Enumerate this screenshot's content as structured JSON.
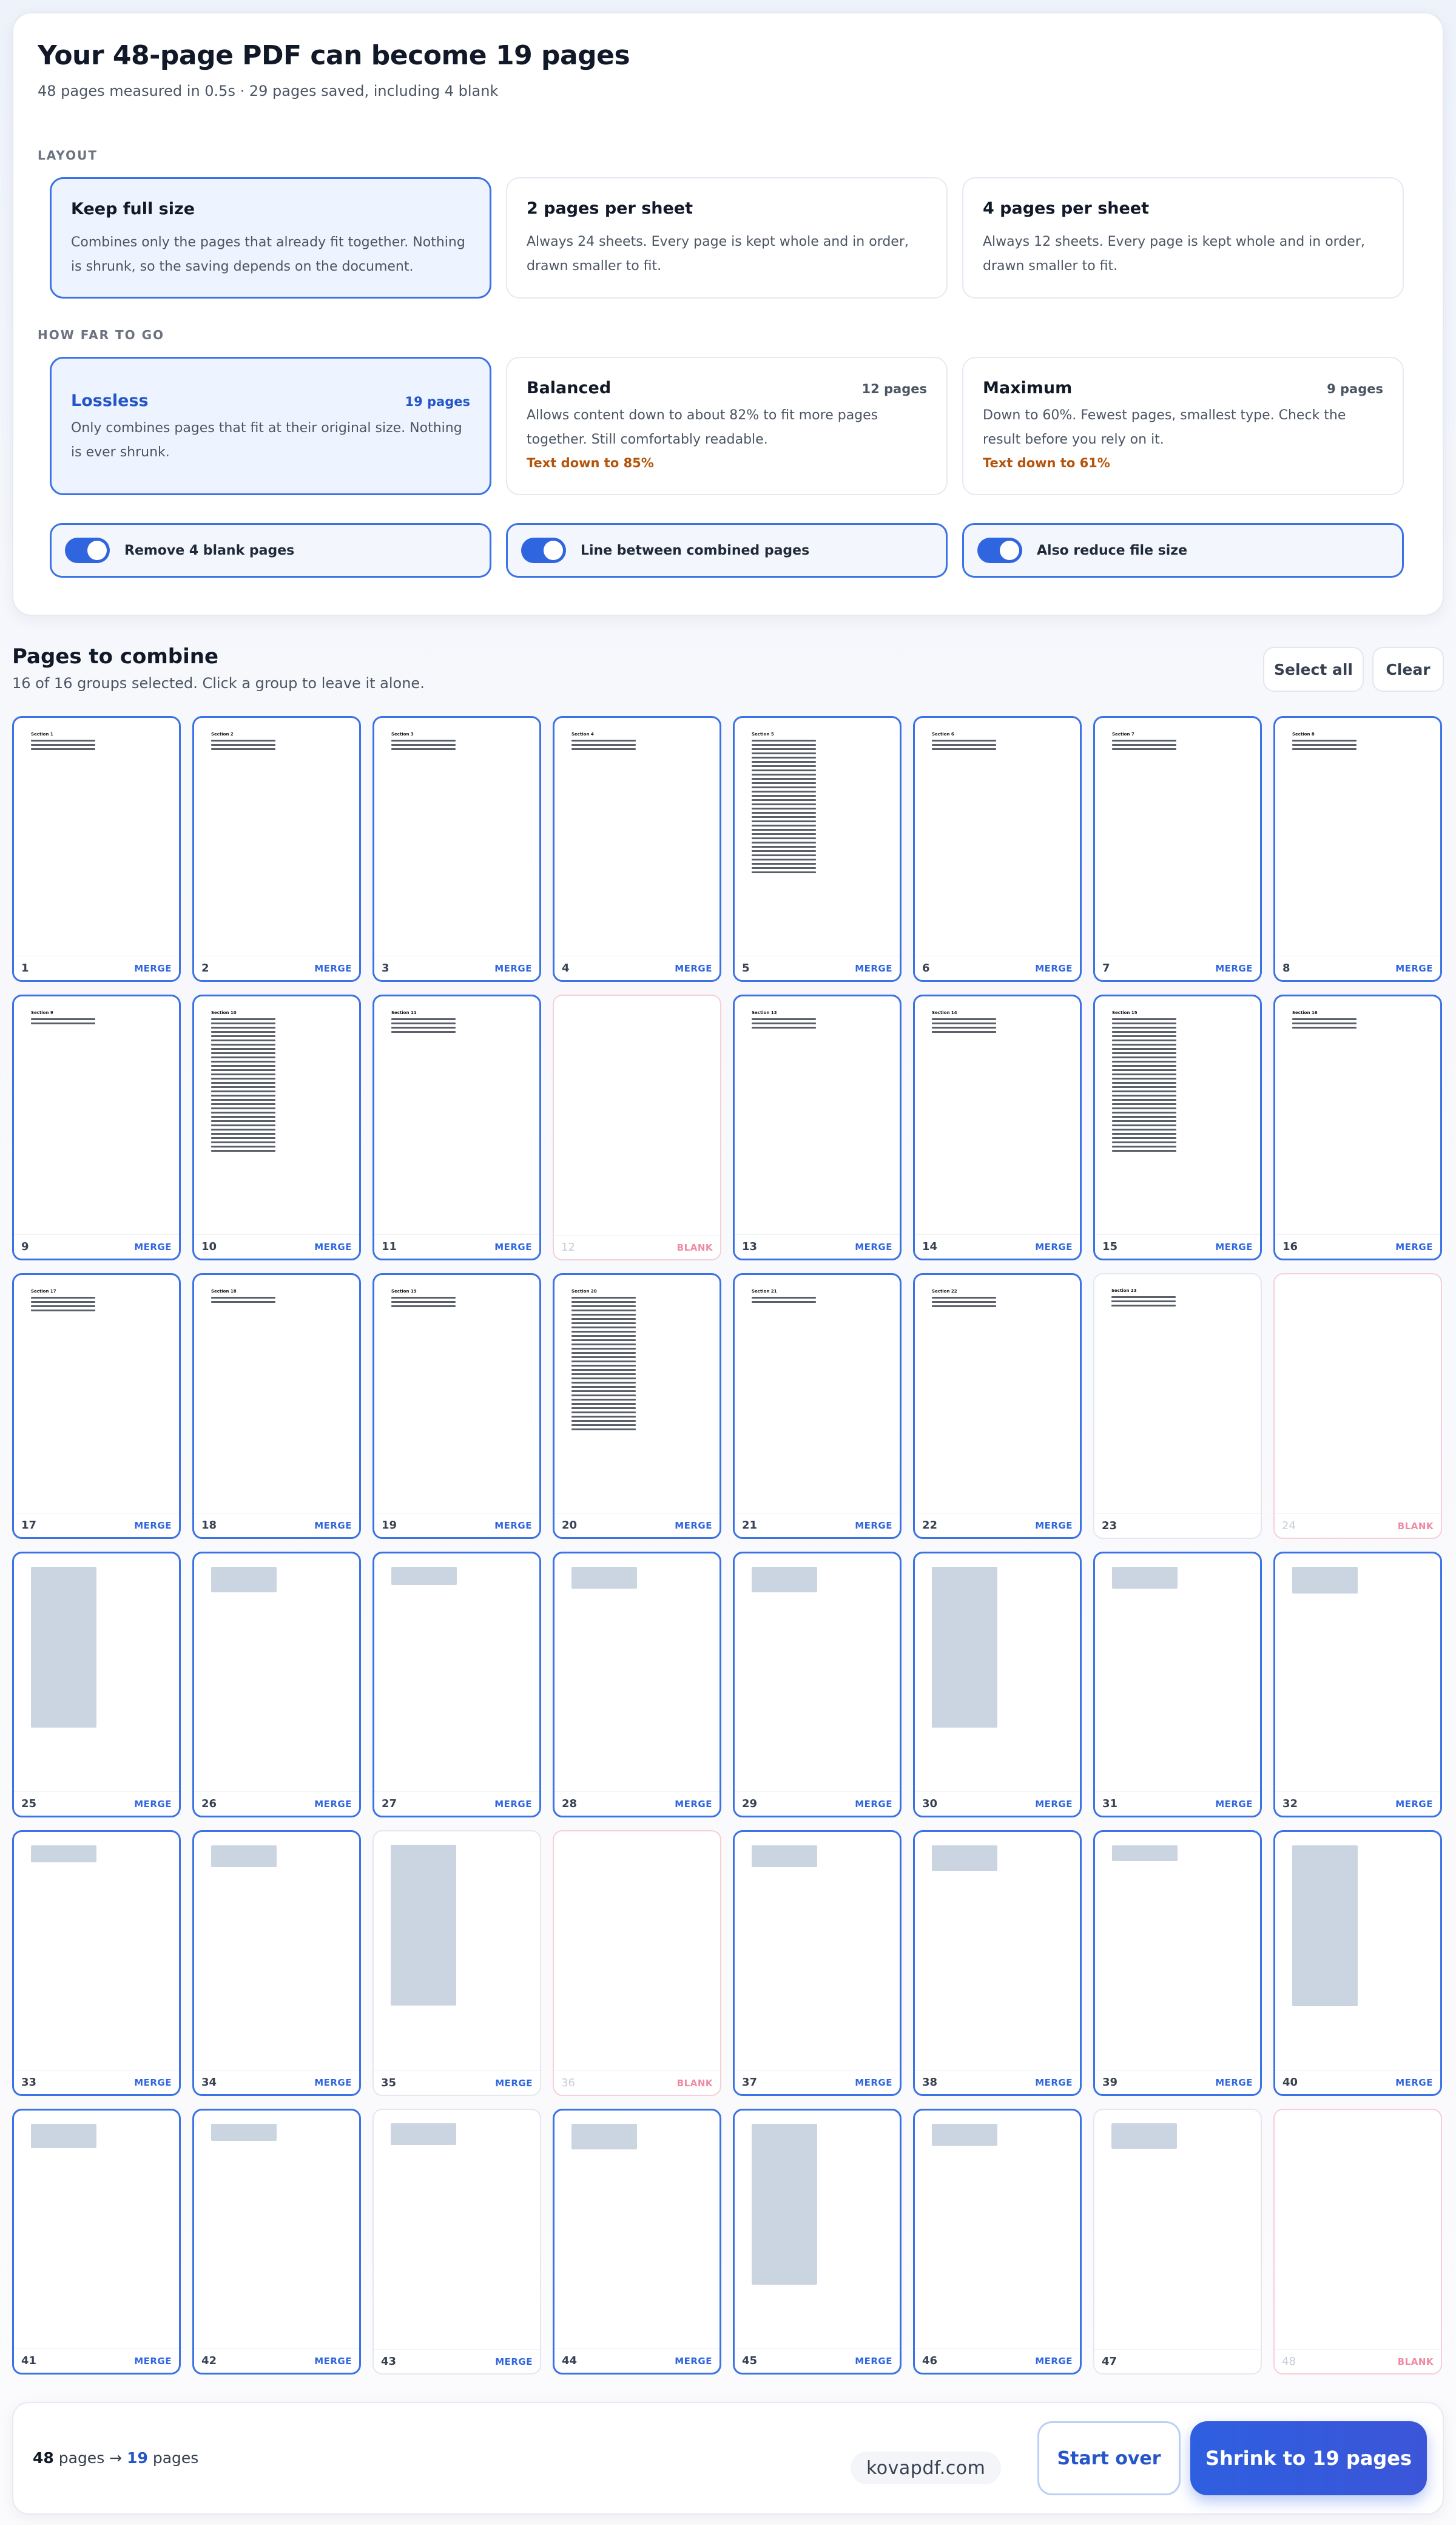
{
  "header": {
    "title": "Your 48-page PDF can become 19 pages",
    "subtitle": "48 pages measured in 0.5s · 29 pages saved, including 4 blank"
  },
  "layout": {
    "label": "LAYOUT",
    "options": [
      {
        "title": "Keep full size",
        "desc": "Combines only the pages that already fit together. Nothing is shrunk, so the saving depends on the document.",
        "selected": true
      },
      {
        "title": "2 pages per sheet",
        "desc": "Always 24 sheets. Every page is kept whole and in order, drawn smaller to fit.",
        "selected": false
      },
      {
        "title": "4 pages per sheet",
        "desc": "Always 12 sheets. Every page is kept whole and in order, drawn smaller to fit.",
        "selected": false
      }
    ]
  },
  "how_far": {
    "label": "HOW FAR TO GO",
    "options": [
      {
        "title": "Lossless",
        "count": "19 pages",
        "desc": "Only combines pages that fit at their original size. Nothing is ever shrunk.",
        "warn": "",
        "selected": true
      },
      {
        "title": "Balanced",
        "count": "12 pages",
        "desc": "Allows content down to about 82% to fit more pages together. Still comfortably readable.",
        "warn": "Text down to 85%",
        "selected": false
      },
      {
        "title": "Maximum",
        "count": "9 pages",
        "desc": "Down to 60%. Fewest pages, smallest type. Check the result before you rely on it.",
        "warn": "Text down to 61%",
        "selected": false
      }
    ]
  },
  "toggles": [
    {
      "label": "Remove 4 blank pages",
      "on": true
    },
    {
      "label": "Line between combined pages",
      "on": true
    },
    {
      "label": "Also reduce file size",
      "on": true
    }
  ],
  "pages_section": {
    "title": "Pages to combine",
    "subtitle": "16 of 16 groups selected. Click a group to leave it alone.",
    "select_all": "Select all",
    "clear": "Clear"
  },
  "tags": {
    "merge": "MERGE",
    "blank": "BLANK"
  },
  "bottom": {
    "from": "48",
    "from_unit": "pages",
    "arrow": "→",
    "to": "19",
    "to_unit": "pages",
    "brand": "kovapdf.com",
    "start_over": "Start over",
    "shrink": "Shrink to 19 pages"
  },
  "colors": {
    "accent": "#3b72e6",
    "primary_button": "#2e5fe0",
    "warning": "#b45309",
    "blank_tag": "#f08aa2"
  }
}
